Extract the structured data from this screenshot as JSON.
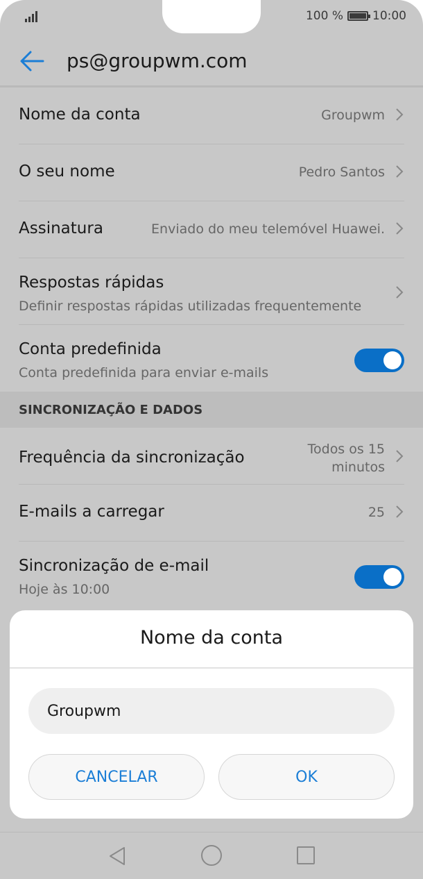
{
  "status": {
    "battery_text": "100 %",
    "time": "10:00"
  },
  "appbar": {
    "title": "ps@groupwm.com"
  },
  "settings": {
    "account_name": {
      "label": "Nome da conta",
      "value": "Groupwm"
    },
    "your_name": {
      "label": "O seu nome",
      "value": "Pedro Santos"
    },
    "signature": {
      "label": "Assinatura",
      "value": "Enviado do meu telemóvel Huawei."
    },
    "quick_replies": {
      "label": "Respostas rápidas",
      "sub": "Definir respostas rápidas utilizadas frequentemente"
    },
    "default_account": {
      "label": "Conta predefinida",
      "sub": "Conta predefinida para enviar e-mails",
      "enabled": true
    }
  },
  "sync_section": {
    "header": "SINCRONIZAÇÃO E DADOS",
    "frequency": {
      "label": "Frequência da sincronização",
      "value_line1": "Todos os 15",
      "value_line2": "minutos"
    },
    "emails_to_load": {
      "label": "E-mails a carregar",
      "value": "25"
    },
    "email_sync": {
      "label": "Sincronização de e-mail",
      "sub": "Hoje às 10:00",
      "enabled": true
    }
  },
  "dialog": {
    "title": "Nome da conta",
    "input_value": "Groupwm",
    "cancel_label": "CANCELAR",
    "ok_label": "OK"
  },
  "colors": {
    "accent": "#1b7ed6",
    "toggle_on": "#0a6fc7"
  }
}
